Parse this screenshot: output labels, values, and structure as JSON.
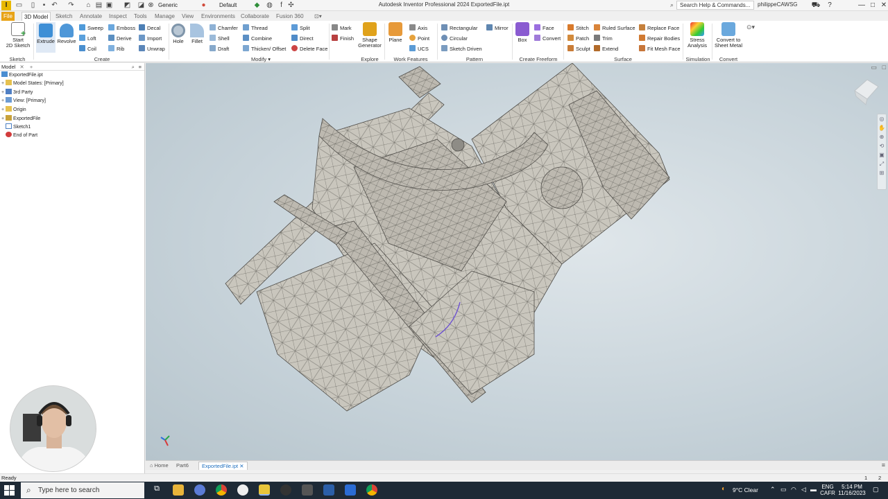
{
  "window": {
    "title": "Autodesk Inventor Professional 2024    ExportedFile.ipt",
    "appearance_dropdown": "Generic",
    "style_dropdown": "Default",
    "search_placeholder": "Search Help & Commands...",
    "user": "philippeCAWSG",
    "controls": [
      "—",
      "□",
      "✕"
    ]
  },
  "menu_tabs": [
    "File",
    "3D Model",
    "Sketch",
    "Annotate",
    "Inspect",
    "Tools",
    "Manage",
    "View",
    "Environments",
    "Collaborate",
    "Fusion 360"
  ],
  "ribbon": {
    "sketch": {
      "start_line1": "Start",
      "start_line2": "2D Sketch",
      "group": "Sketch"
    },
    "create": {
      "extrude": "Extrude",
      "revolve": "Revolve",
      "sweep": "Sweep",
      "loft": "Loft",
      "coil": "Coil",
      "emboss": "Emboss",
      "derive": "Derive",
      "rib": "Rib",
      "decal": "Decal",
      "import": "Import",
      "unwrap": "Unwrap",
      "group": "Create"
    },
    "modify": {
      "hole": "Hole",
      "fillet": "Fillet",
      "chamfer": "Chamfer",
      "shell": "Shell",
      "draft": "Draft",
      "thread": "Thread",
      "combine": "Combine",
      "thicken": "Thicken/ Offset",
      "split": "Split",
      "direct": "Direct",
      "delete_face": "Delete Face",
      "group": "Modify ▾"
    },
    "explore": {
      "mark": "Mark",
      "finish": "Finish",
      "shape_line1": "Shape",
      "shape_line2": "Generator",
      "group": "Explore"
    },
    "work_features": {
      "plane": "Plane",
      "axis": "Axis",
      "point": "Point",
      "ucs": "UCS",
      "group": "Work Features"
    },
    "pattern": {
      "rectangular": "Rectangular",
      "circular": "Circular",
      "sketch_driven": "Sketch Driven",
      "mirror": "Mirror",
      "group": "Pattern"
    },
    "freeform": {
      "box": "Box",
      "face": "Face",
      "convert": "Convert",
      "group": "Create Freeform"
    },
    "surface": {
      "stitch": "Stitch",
      "patch": "Patch",
      "sculpt": "Sculpt",
      "ruled_surface": "Ruled Surface",
      "trim": "Trim",
      "extend": "Extend",
      "replace_face": "Replace Face",
      "repair_bodies": "Repair Bodies",
      "fit_mesh_face": "Fit Mesh Face",
      "group": "Surface"
    },
    "simulation": {
      "stress_line1": "Stress",
      "stress_line2": "Analysis",
      "group": "Simulation"
    },
    "convert": {
      "sheet_line1": "Convert to",
      "sheet_line2": "Sheet Metal",
      "group": "Convert"
    }
  },
  "browser": {
    "tab": "Model",
    "items": [
      {
        "label": "ExportedFile.ipt",
        "expand": ""
      },
      {
        "label": "Model States: [Primary]",
        "expand": "+"
      },
      {
        "label": "3rd Party",
        "expand": "+"
      },
      {
        "label": "View: [Primary]",
        "expand": "+"
      },
      {
        "label": "Origin",
        "expand": "+"
      },
      {
        "label": "ExportedFile",
        "expand": "+"
      },
      {
        "label": "Sketch1",
        "expand": ""
      },
      {
        "label": "End of Part",
        "expand": ""
      }
    ]
  },
  "doc_tabs": [
    "Home",
    "Part6",
    "ExportedFile.ipt"
  ],
  "status": {
    "left": "Ready",
    "page_a": "1",
    "page_b": "2"
  },
  "taskbar": {
    "search_placeholder": "Type here to search",
    "weather": "9°C  Clear",
    "lang_line1": "ENG",
    "lang_line2": "CAFR",
    "time": "5:14 PM",
    "date": "11/16/2023"
  },
  "colors": {
    "accent_file_tab": "#e8a317",
    "active_doc_tab": "#1f6fbf",
    "taskbar": "#1e2a36"
  }
}
